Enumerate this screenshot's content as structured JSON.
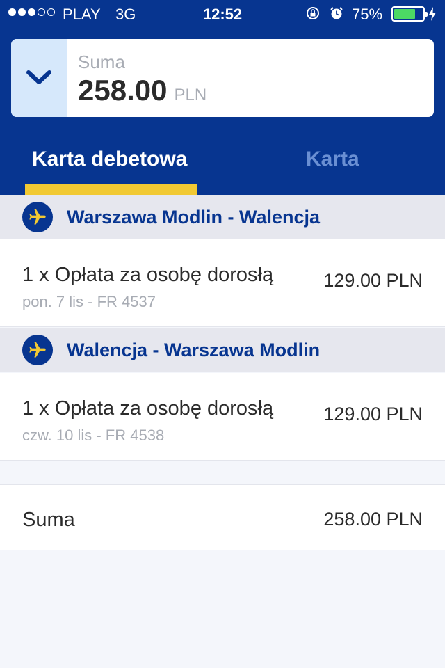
{
  "status_bar": {
    "signal_dots": [
      true,
      true,
      true,
      false,
      false
    ],
    "carrier": "PLAY",
    "network": "3G",
    "time": "12:52",
    "battery_percent": "75%",
    "battery_level": 0.75,
    "icons": [
      "rotation-lock-icon",
      "alarm-icon",
      "battery-icon",
      "charging-icon"
    ]
  },
  "summary": {
    "label": "Suma",
    "amount": "258.00",
    "currency": "PLN",
    "toggle_icon": "chevron-down-icon"
  },
  "tabs": [
    {
      "label": "Karta debetowa",
      "active": true
    },
    {
      "label": "Karta",
      "active": false
    }
  ],
  "flights": [
    {
      "icon": "plane-icon",
      "route": "Warszawa Modlin - Walencja",
      "fee": {
        "description": "1 x Opłata za osobę dorosłą",
        "detail": "pon. 7 lis - FR 4537",
        "price": "129.00 PLN"
      }
    },
    {
      "icon": "plane-icon",
      "route": "Walencja - Warszawa Modlin",
      "fee": {
        "description": "1 x Opłata za osobę dorosłą",
        "detail": "czw. 10 lis - FR 4538",
        "price": "129.00 PLN"
      }
    }
  ],
  "total": {
    "label": "Suma",
    "value": "258.00 PLN"
  },
  "colors": {
    "brand_blue": "#073590",
    "accent_yellow": "#f1c933",
    "inactive_tab": "#6a8fd3",
    "battery_green": "#4cd964"
  }
}
